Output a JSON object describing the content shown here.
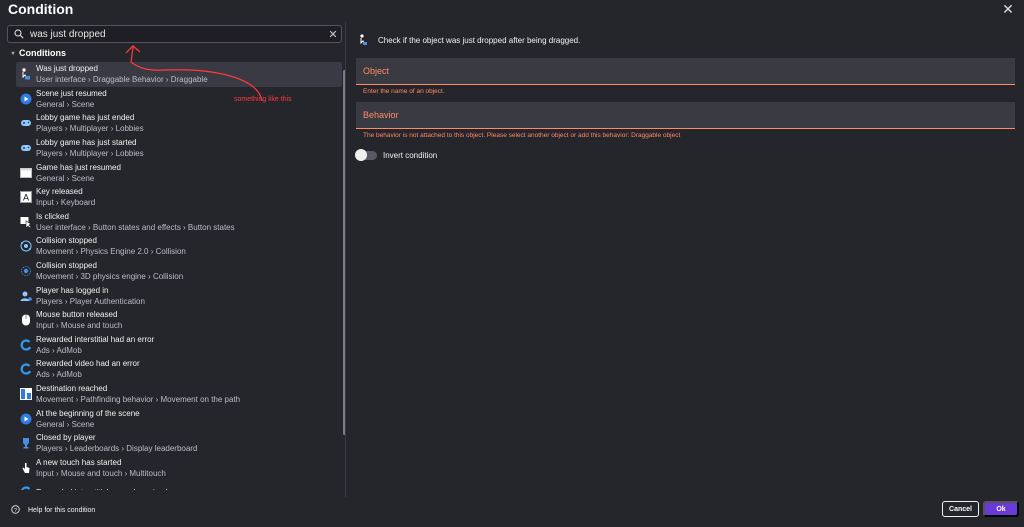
{
  "dialog": {
    "title": "Condition",
    "close_icon": "close-icon"
  },
  "search": {
    "value": "was just dropped",
    "placeholder": ""
  },
  "group": {
    "label": "Conditions"
  },
  "items": [
    {
      "name": "Was just dropped",
      "path": "User interface › Draggable Behavior › Draggable",
      "icon": "drag-icon",
      "selected": true
    },
    {
      "name": "Scene just resumed",
      "path": "General › Scene",
      "icon": "scene-play-icon"
    },
    {
      "name": "Lobby game has just ended",
      "path": "Players › Multiplayer › Lobbies",
      "icon": "gamepad-icon"
    },
    {
      "name": "Lobby game has just started",
      "path": "Players › Multiplayer › Lobbies",
      "icon": "gamepad-icon"
    },
    {
      "name": "Game has just resumed",
      "path": "General › Scene",
      "icon": "window-icon"
    },
    {
      "name": "Key released",
      "path": "Input › Keyboard",
      "icon": "key-icon"
    },
    {
      "name": "Is clicked",
      "path": "User interface › Button states and effects › Button states",
      "icon": "cursor-icon"
    },
    {
      "name": "Collision stopped",
      "path": "Movement › Physics Engine 2.0 › Collision",
      "icon": "physics-icon"
    },
    {
      "name": "Collision stopped",
      "path": "Movement › 3D physics engine › Collision",
      "icon": "physics-3d-icon"
    },
    {
      "name": "Player has logged in",
      "path": "Players › Player Authentication",
      "icon": "user-icon"
    },
    {
      "name": "Mouse button released",
      "path": "Input › Mouse and touch",
      "icon": "mouse-icon"
    },
    {
      "name": "Rewarded interstitial had an error",
      "path": "Ads › AdMob",
      "icon": "admob-icon"
    },
    {
      "name": "Rewarded video had an error",
      "path": "Ads › AdMob",
      "icon": "admob-icon"
    },
    {
      "name": "Destination reached",
      "path": "Movement › Pathfinding behavior › Movement on the path",
      "icon": "pathfinding-icon"
    },
    {
      "name": "At the beginning of the scene",
      "path": "General › Scene",
      "icon": "scene-play-icon"
    },
    {
      "name": "Closed by player",
      "path": "Players › Leaderboards › Display leaderboard",
      "icon": "trophy-icon"
    },
    {
      "name": "A new touch has started",
      "path": "Input › Mouse and touch › Multitouch",
      "icon": "touch-icon"
    },
    {
      "name": "Rewarded interstitial reward received",
      "path": "",
      "icon": "admob-icon"
    }
  ],
  "annotation": {
    "text": "something like this"
  },
  "right": {
    "description": "Check if the object was just dropped after being dragged.",
    "object_label": "Object",
    "object_error": "Enter the name of an object.",
    "behavior_label": "Behavior",
    "behavior_error": "The behavior is not attached to this object. Please select another object or add this behavior: Draggable object",
    "invert_label": "Invert condition",
    "invert_on": false
  },
  "footer": {
    "help_label": "Help for this condition",
    "cancel_label": "Cancel",
    "ok_label": "Ok"
  },
  "colors": {
    "accent": "#6a3ad9",
    "error": "#ff8a65",
    "annotation": "#ff3b3b",
    "background": "#25252c"
  }
}
